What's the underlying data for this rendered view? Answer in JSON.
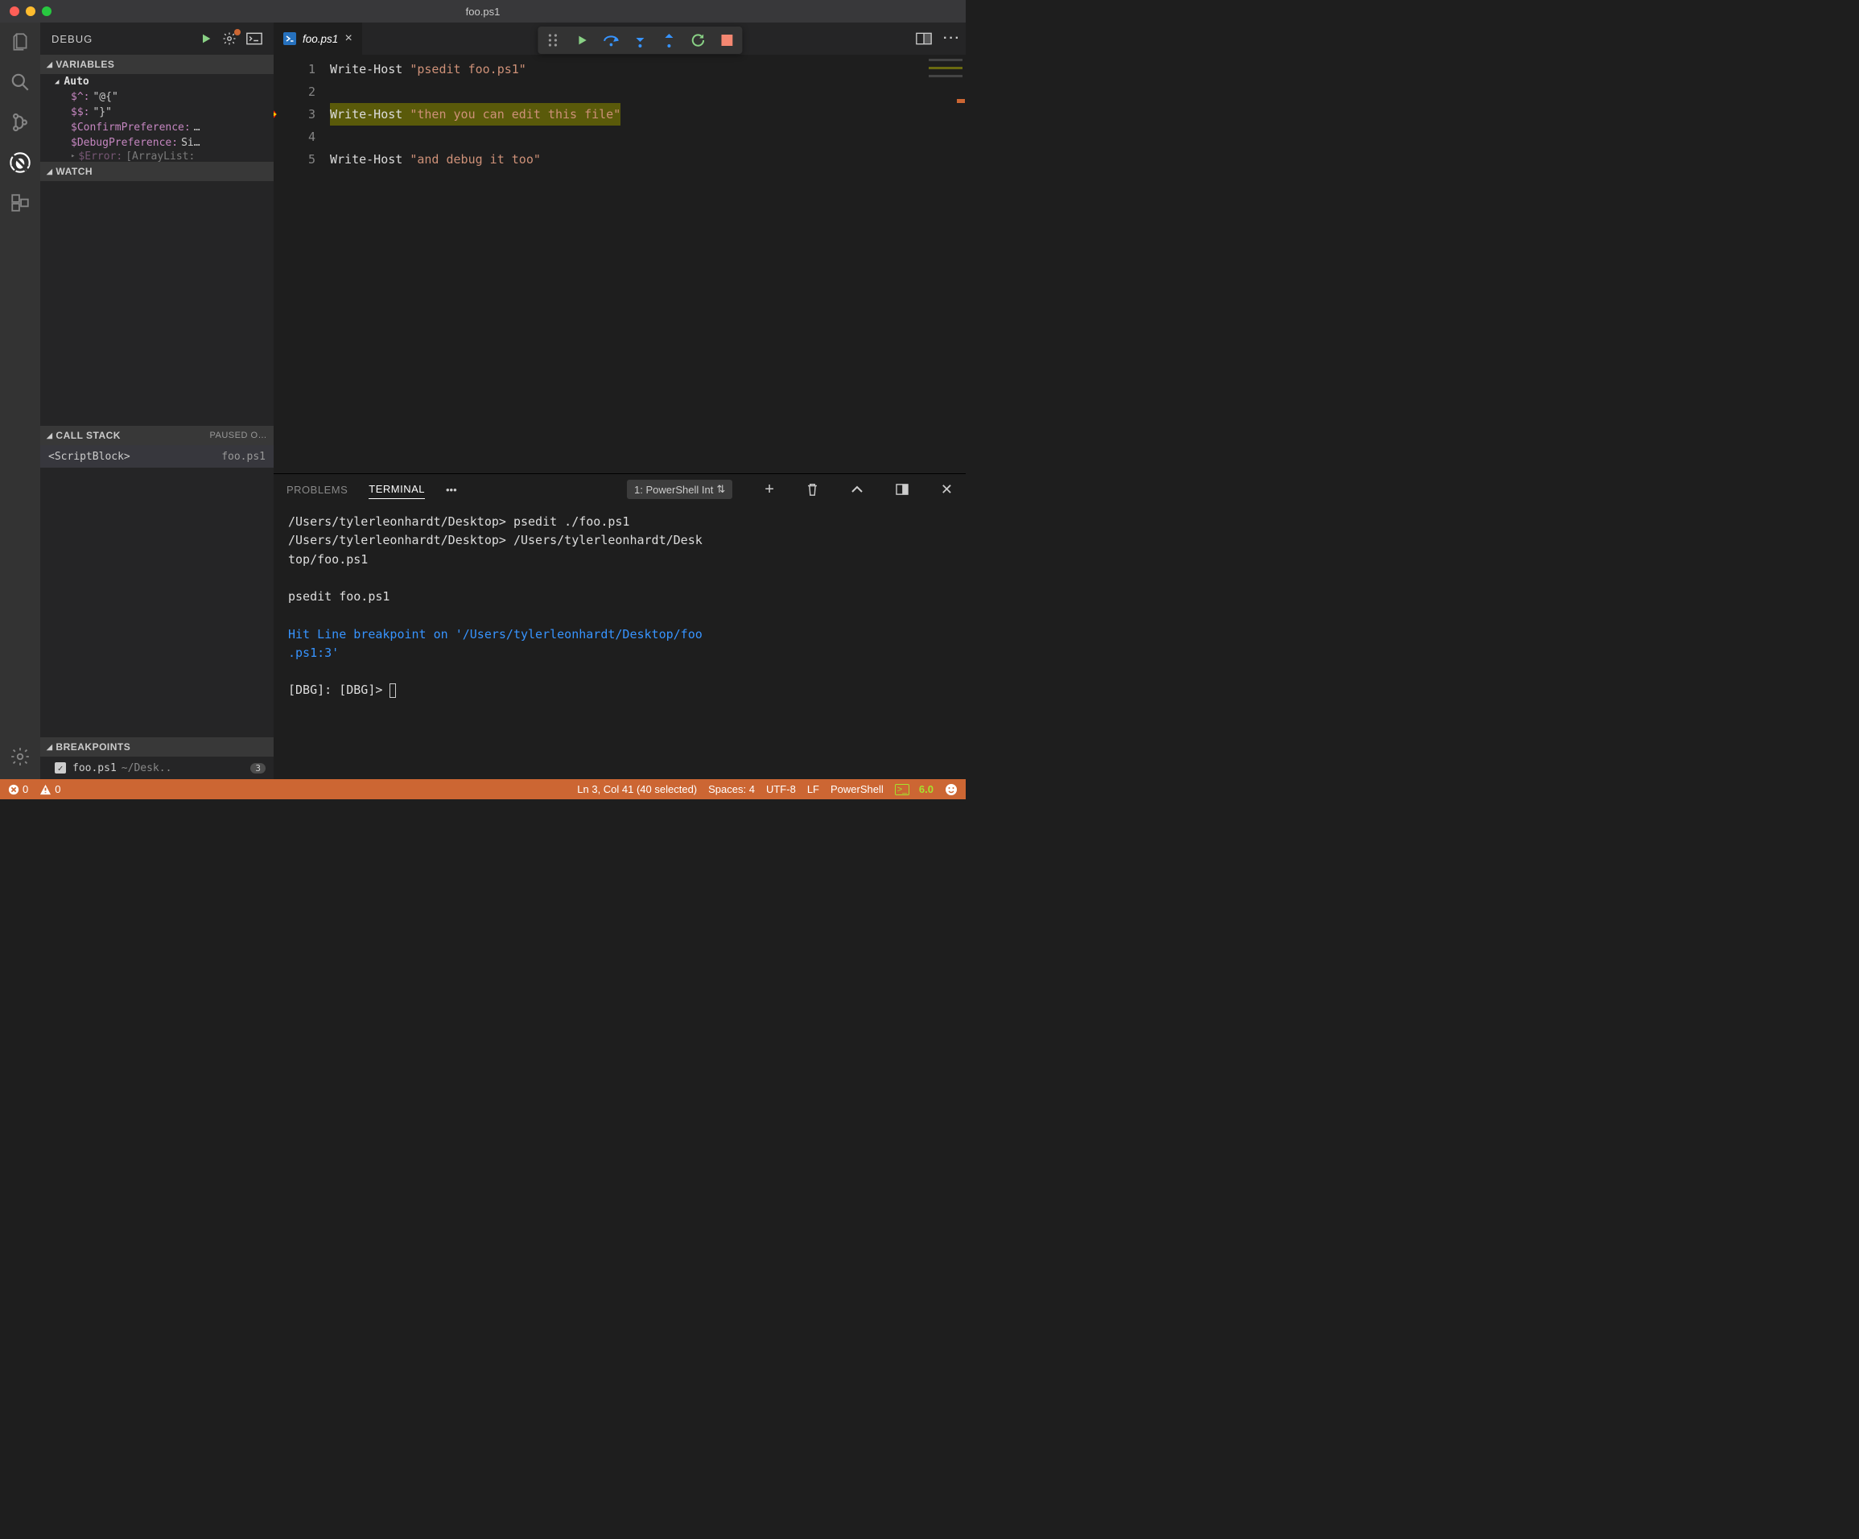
{
  "window": {
    "title": "foo.ps1"
  },
  "activity": {
    "active": "debug"
  },
  "debugPanel": {
    "title": "DEBUG",
    "sections": {
      "variables": {
        "label": "VARIABLES",
        "autoLabel": "Auto",
        "items": [
          {
            "name": "$^:",
            "val": "\"@{\""
          },
          {
            "name": "$$:",
            "val": "\"}\""
          },
          {
            "name": "$ConfirmPreference:",
            "val": "…"
          },
          {
            "name": "$DebugPreference:",
            "val": "Si…"
          },
          {
            "name": "$Error:",
            "val": "[ArrayList:"
          }
        ]
      },
      "watch": {
        "label": "WATCH"
      },
      "callstack": {
        "label": "CALL STACK",
        "status": "PAUSED O…",
        "frames": [
          {
            "name": "<ScriptBlock>",
            "file": "foo.ps1"
          }
        ]
      },
      "breakpoints": {
        "label": "BREAKPOINTS",
        "items": [
          {
            "file": "foo.ps1",
            "path": "~/Desk..",
            "line": "3",
            "checked": true
          }
        ]
      }
    }
  },
  "tabs": {
    "active": {
      "label": "foo.ps1",
      "iconGlyph": ">_"
    }
  },
  "debugToolbar": {
    "continue": "continue",
    "stepOver": "step-over",
    "stepInto": "step-into",
    "stepOut": "step-out",
    "restart": "restart",
    "stop": "stop"
  },
  "editor": {
    "lines": [
      {
        "n": "1",
        "cmd": "Write-Host",
        "str": "\"psedit foo.ps1\""
      },
      {
        "n": "2",
        "cmd": "",
        "str": ""
      },
      {
        "n": "3",
        "cmd": "Write-Host",
        "str": "\"then you can edit this file\"",
        "current": true
      },
      {
        "n": "4",
        "cmd": "",
        "str": ""
      },
      {
        "n": "5",
        "cmd": "Write-Host",
        "str": "\"and debug it too\""
      }
    ],
    "breakpointLine": 3
  },
  "panel": {
    "tabs": {
      "problems": "PROBLEMS",
      "terminal": "TERMINAL"
    },
    "terminalSelector": "1: PowerShell Int",
    "terminal": {
      "l1a": "/Users/tylerleonhardt/Desktop>",
      "l1b": "psedit ./foo.ps1",
      "l2a": "/Users/tylerleonhardt/Desktop>",
      "l2b": "/Users/tylerleonhardt/Desk",
      "l2c": "top/foo.ps1",
      "l4": "psedit foo.ps1",
      "l6": "Hit Line breakpoint on '/Users/tylerleonhardt/Desktop/foo",
      "l6b": ".ps1:3'",
      "l8": "[DBG]:  [DBG]> "
    }
  },
  "status": {
    "errors": "0",
    "warnings": "0",
    "position": "Ln 3, Col 41 (40 selected)",
    "spaces": "Spaces: 4",
    "encoding": "UTF-8",
    "eol": "LF",
    "language": "PowerShell",
    "psVersion": "6.0"
  }
}
